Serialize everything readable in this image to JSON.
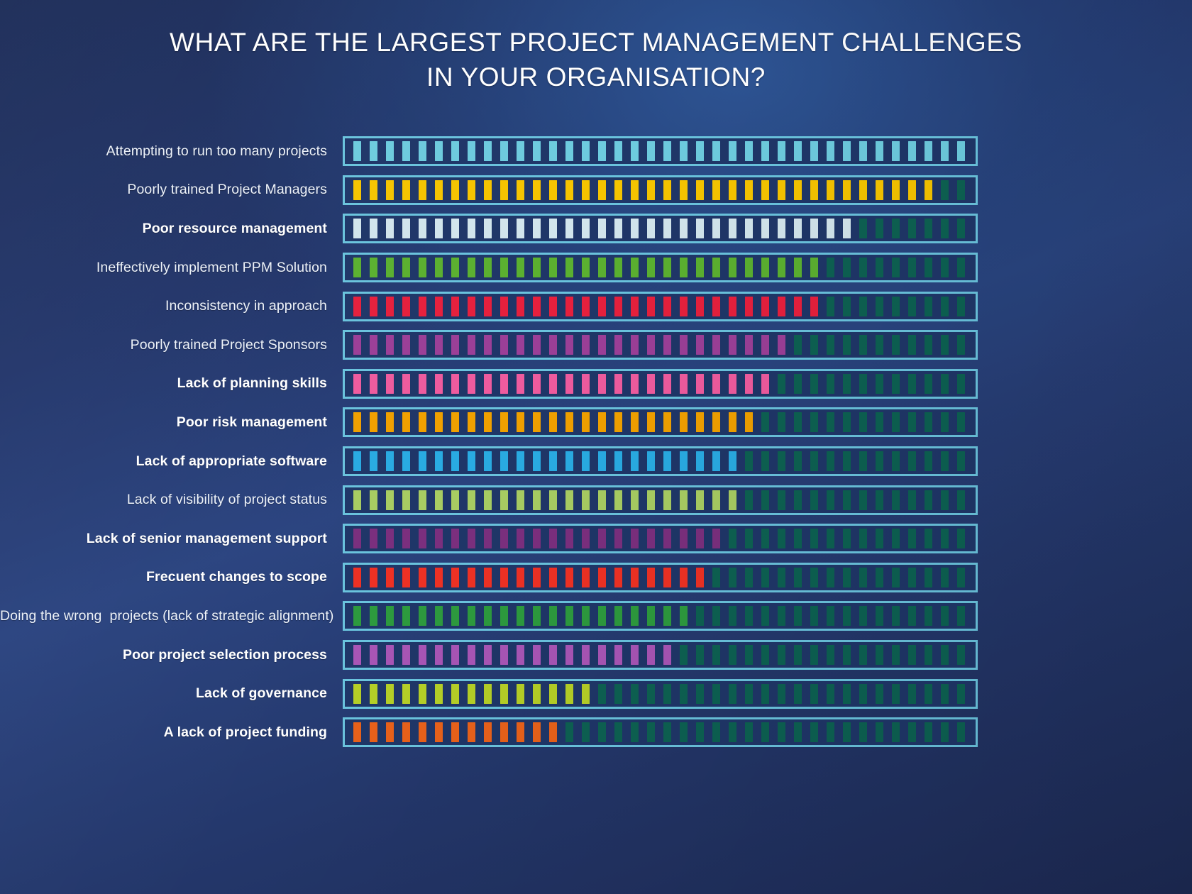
{
  "title": {
    "line1": "WHAT ARE THE LARGEST PROJECT MANAGEMENT CHALLENGES",
    "line2": "IN YOUR ORGANISATION?"
  },
  "colors": {
    "background_deep": "#1b2b57",
    "background_light": "#2b4480",
    "track_border": "#6ac3dd",
    "track_fill": "#1f3668",
    "empty_segment": "#0d6152",
    "label_text": "#eef3fa"
  },
  "chart_data": {
    "type": "bar",
    "title": "WHAT ARE THE LARGEST PROJECT MANAGEMENT CHALLENGES IN YOUR ORGANISATION?",
    "xlabel": "",
    "ylabel": "",
    "orientation": "horizontal",
    "grid": false,
    "legend_position": "none",
    "total_segments": 38,
    "note": "Each bar is a segmented progress track of 38 ticks; filled ticks are the colored value, unfilled ticks are dark teal.",
    "categories": [
      "Attempting to run too many projects",
      "Poorly trained Project Managers",
      "Poor resource management",
      "Ineffectively implement PPM Solution",
      "Inconsistency in approach",
      "Poorly trained Project Sponsors",
      "Lack of planning skills",
      "Poor risk management",
      "Lack of appropriate software",
      "Lack of visibility of project status",
      "Lack of senior management support",
      "Frecuent changes to scope",
      "Doing the wrong  projects (lack of strategic alignment)",
      "Poor project selection process",
      "Lack of governance",
      "A lack of project funding"
    ],
    "values": [
      38,
      36,
      31,
      29,
      29,
      27,
      26,
      25,
      24,
      24,
      23,
      22,
      21,
      20,
      15,
      13
    ],
    "colors": [
      "#6dcbde",
      "#f5c400",
      "#d2e5ec",
      "#5bb030",
      "#e6203d",
      "#9b3f97",
      "#ee5b9e",
      "#f0a000",
      "#29abe2",
      "#a8cc62",
      "#7b2f7e",
      "#ee3124",
      "#2d9a3e",
      "#a855b5",
      "#b5cf27",
      "#e8611a"
    ],
    "bold_labels": [
      false,
      false,
      true,
      false,
      false,
      false,
      true,
      true,
      true,
      false,
      true,
      true,
      false,
      true,
      true,
      true
    ]
  }
}
